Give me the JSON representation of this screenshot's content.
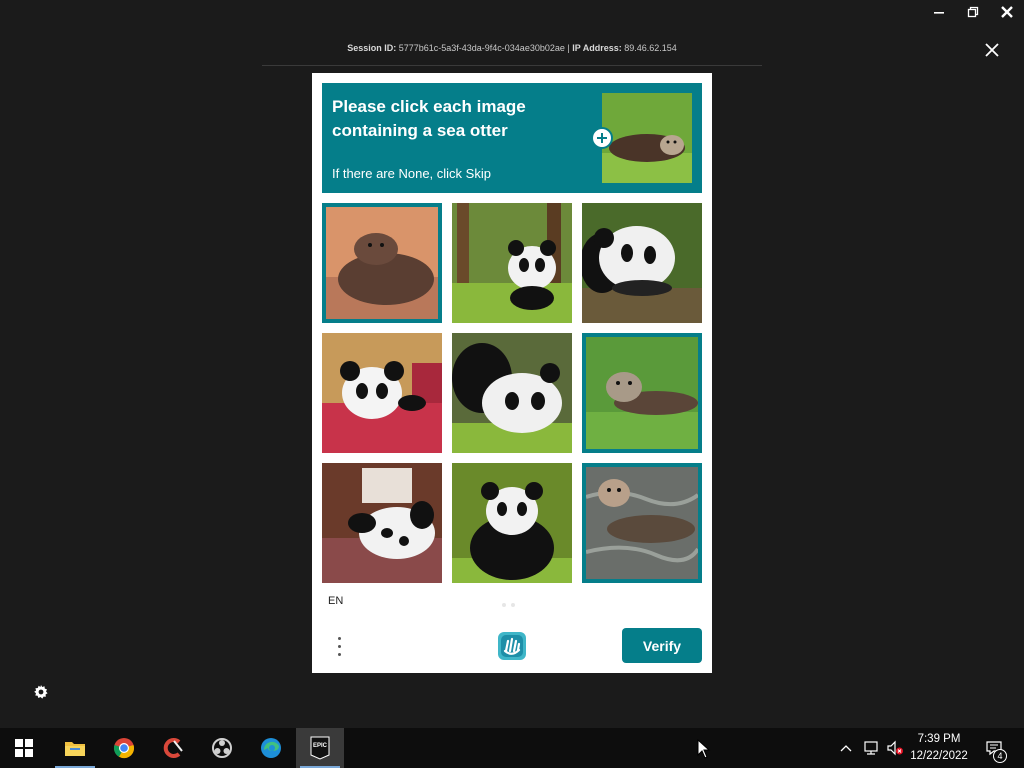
{
  "window_controls": {
    "minimize_icon": "minimize-icon",
    "restore_icon": "restore-icon",
    "close_icon": "close-icon"
  },
  "session": {
    "session_label": "Session ID:",
    "session_id": " 5777b61c-5a3f-43da-9f4c-034ae30b02ae | ",
    "ip_label": "IP Address:",
    "ip_value": " 89.46.62.154"
  },
  "captcha": {
    "prompt_title": "Please click each image containing a sea otter",
    "prompt_sub": "If there are None, click Skip",
    "accent_color": "#057e8a",
    "tiles": [
      {
        "subject": "sea otter",
        "selected": true
      },
      {
        "subject": "panda",
        "selected": false
      },
      {
        "subject": "panda",
        "selected": false
      },
      {
        "subject": "panda",
        "selected": false
      },
      {
        "subject": "panda",
        "selected": false
      },
      {
        "subject": "sea otter",
        "selected": true
      },
      {
        "subject": "panda",
        "selected": false
      },
      {
        "subject": "panda",
        "selected": false
      },
      {
        "subject": "sea otter",
        "selected": true
      }
    ],
    "language": "EN",
    "verify_label": "Verify"
  },
  "taskbar": {
    "apps": [
      "start-icon",
      "file-explorer-icon",
      "chrome-icon",
      "ccleaner-icon",
      "obs-icon",
      "edge-icon",
      "epic-games-icon"
    ],
    "epic_label": "EPIC",
    "time": "7:39 PM",
    "date": "12/22/2022",
    "notification_count": "4"
  }
}
